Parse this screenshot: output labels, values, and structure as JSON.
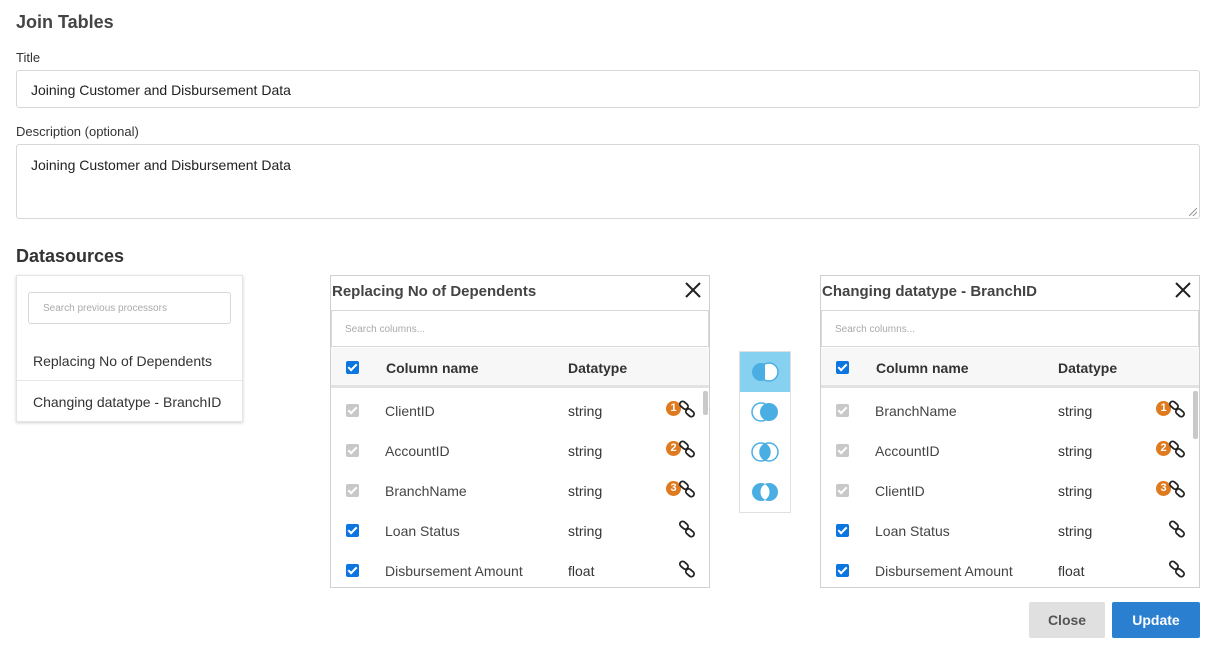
{
  "dialog": {
    "heading": "Join Tables",
    "title_label": "Title",
    "title_value": "Joining Customer and Disbursement Data",
    "description_label": "Description (optional)",
    "description_value": "Joining Customer and Disbursement Data",
    "datasources_heading": "Datasources"
  },
  "datasources": {
    "search_placeholder": "Search previous processors",
    "items": [
      {
        "label": "Replacing No of Dependents"
      },
      {
        "label": "Changing datatype - BranchID"
      }
    ]
  },
  "left_table": {
    "name": "Replacing No of Dependents",
    "search_placeholder": "Search columns...",
    "col_name_header": "Column name",
    "col_type_header": "Datatype",
    "rows": [
      {
        "name": "ClientID",
        "type": "string",
        "badge": "1",
        "checked": "disabled"
      },
      {
        "name": "AccountID",
        "type": "string",
        "badge": "2",
        "checked": "disabled"
      },
      {
        "name": "BranchName",
        "type": "string",
        "badge": "3",
        "checked": "disabled"
      },
      {
        "name": "Loan Status",
        "type": "string",
        "badge": "",
        "checked": "on"
      },
      {
        "name": "Disbursement Amount",
        "type": "float",
        "badge": "",
        "checked": "on"
      }
    ]
  },
  "right_table": {
    "name": "Changing datatype - BranchID",
    "search_placeholder": "Search columns...",
    "col_name_header": "Column name",
    "col_type_header": "Datatype",
    "rows": [
      {
        "name": "BranchName",
        "type": "string",
        "badge": "1",
        "checked": "disabled"
      },
      {
        "name": "AccountID",
        "type": "string",
        "badge": "2",
        "checked": "disabled"
      },
      {
        "name": "ClientID",
        "type": "string",
        "badge": "3",
        "checked": "disabled"
      },
      {
        "name": "Loan Status",
        "type": "string",
        "badge": "",
        "checked": "on"
      },
      {
        "name": "Disbursement Amount",
        "type": "float",
        "badge": "",
        "checked": "on"
      }
    ]
  },
  "join_types": {
    "icons": [
      "left-join-icon",
      "right-join-icon",
      "inner-join-icon",
      "full-join-icon"
    ],
    "active": "left-join-icon"
  },
  "colors": {
    "primary": "#2b7fd0",
    "checkbox": "#0b76e0",
    "badge": "#e07a1f",
    "join_active": "#86d1ef",
    "join_icon": "#4aaee3"
  },
  "footer": {
    "close_label": "Close",
    "update_label": "Update"
  }
}
